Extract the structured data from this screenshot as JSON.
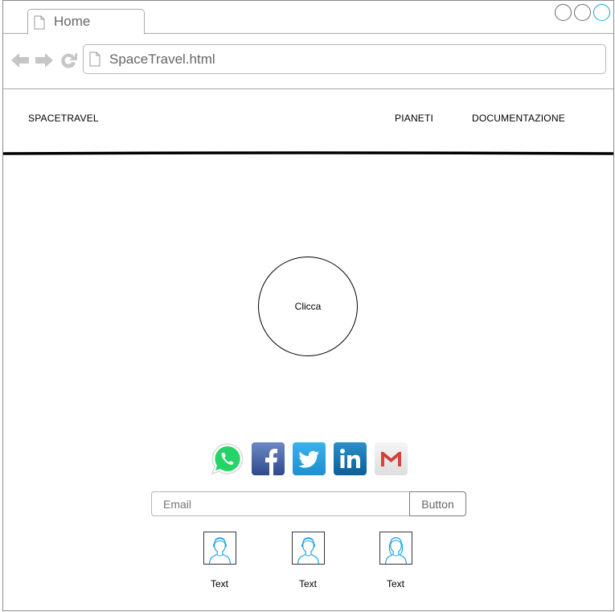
{
  "browser": {
    "tab_title": "Home",
    "address": "SpaceTravel.html",
    "accent": "#1ba1e2"
  },
  "site": {
    "brand": "SPACETRAVEL",
    "menu": [
      {
        "label": "PIANETI"
      },
      {
        "label": "DOCUMENTAZIONE"
      }
    ]
  },
  "main": {
    "cta_label": "Clicca",
    "social": [
      {
        "icon": "whatsapp-icon"
      },
      {
        "icon": "facebook-icon"
      },
      {
        "icon": "twitter-icon"
      },
      {
        "icon": "linkedin-icon"
      },
      {
        "icon": "gmail-icon"
      }
    ],
    "subscribe": {
      "placeholder": "Email",
      "button_label": "Button"
    },
    "people": [
      {
        "label": "Text",
        "icon": "user-male-icon"
      },
      {
        "label": "Text",
        "icon": "user-male-icon"
      },
      {
        "label": "Text",
        "icon": "user-female-icon"
      }
    ]
  }
}
